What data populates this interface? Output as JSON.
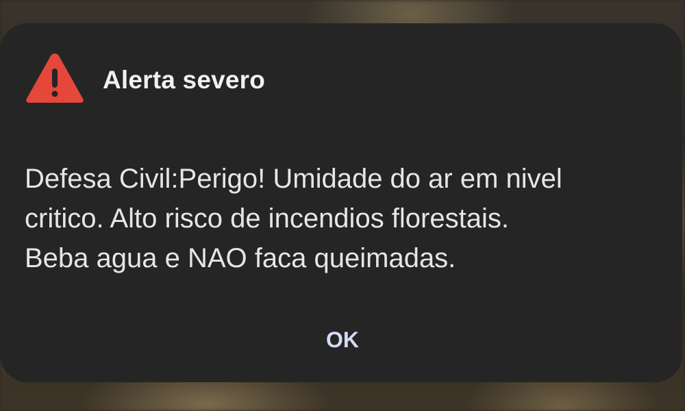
{
  "alert": {
    "icon": "warning-triangle-icon",
    "icon_color": "#e5483b",
    "title": "Alerta severo",
    "message_lines": [
      "Defesa Civil:Perigo! Umidade do ar em nivel",
      "critico. Alto risco de incendios florestais.",
      "Beba agua e NAO faca queimadas."
    ],
    "ok_label": "OK",
    "ok_color": "#d5dbf5",
    "background_color": "#252526"
  }
}
